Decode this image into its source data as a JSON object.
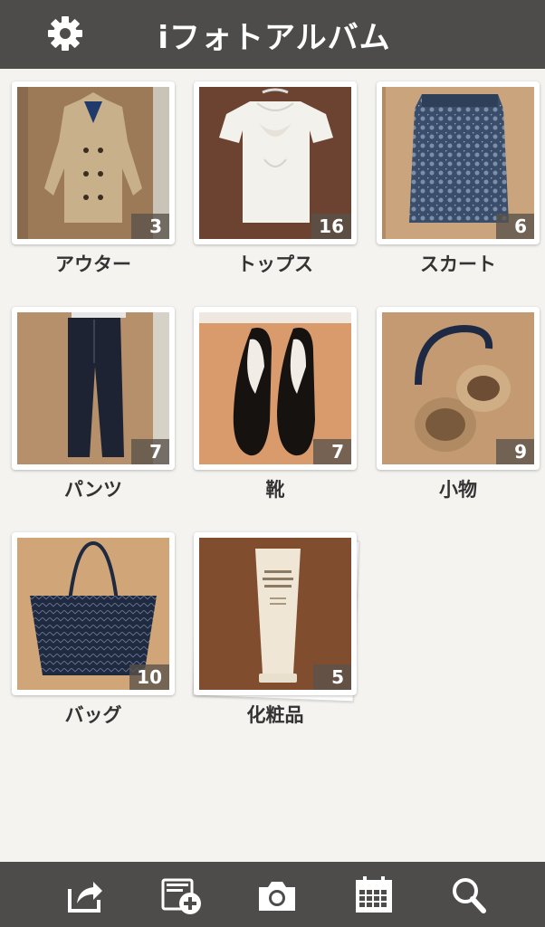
{
  "header": {
    "title": "iフォトアルバム",
    "settings_icon": "gear-icon"
  },
  "albums": [
    {
      "label": "アウター",
      "count": "3",
      "thumbnail": "beige-trench-coat-photo"
    },
    {
      "label": "トップス",
      "count": "16",
      "thumbnail": "white-blouse-photo"
    },
    {
      "label": "スカート",
      "count": "6",
      "thumbnail": "patterned-skirt-photo"
    },
    {
      "label": "パンツ",
      "count": "7",
      "thumbnail": "navy-trousers-photo"
    },
    {
      "label": "靴",
      "count": "7",
      "thumbnail": "black-pumps-photo"
    },
    {
      "label": "小物",
      "count": "9",
      "thumbnail": "fur-earmuffs-photo"
    },
    {
      "label": "バッグ",
      "count": "10",
      "thumbnail": "tote-bag-photo"
    },
    {
      "label": "化粧品",
      "count": "5",
      "thumbnail": "lotion-tube-photo"
    }
  ],
  "toolbar": {
    "icons": [
      "share-icon",
      "add-album-icon",
      "camera-icon",
      "calendar-icon",
      "search-icon"
    ]
  },
  "colors": {
    "bar": "#4e4c4b",
    "background": "#f4f3f0",
    "count_badge": "#5a524a"
  }
}
